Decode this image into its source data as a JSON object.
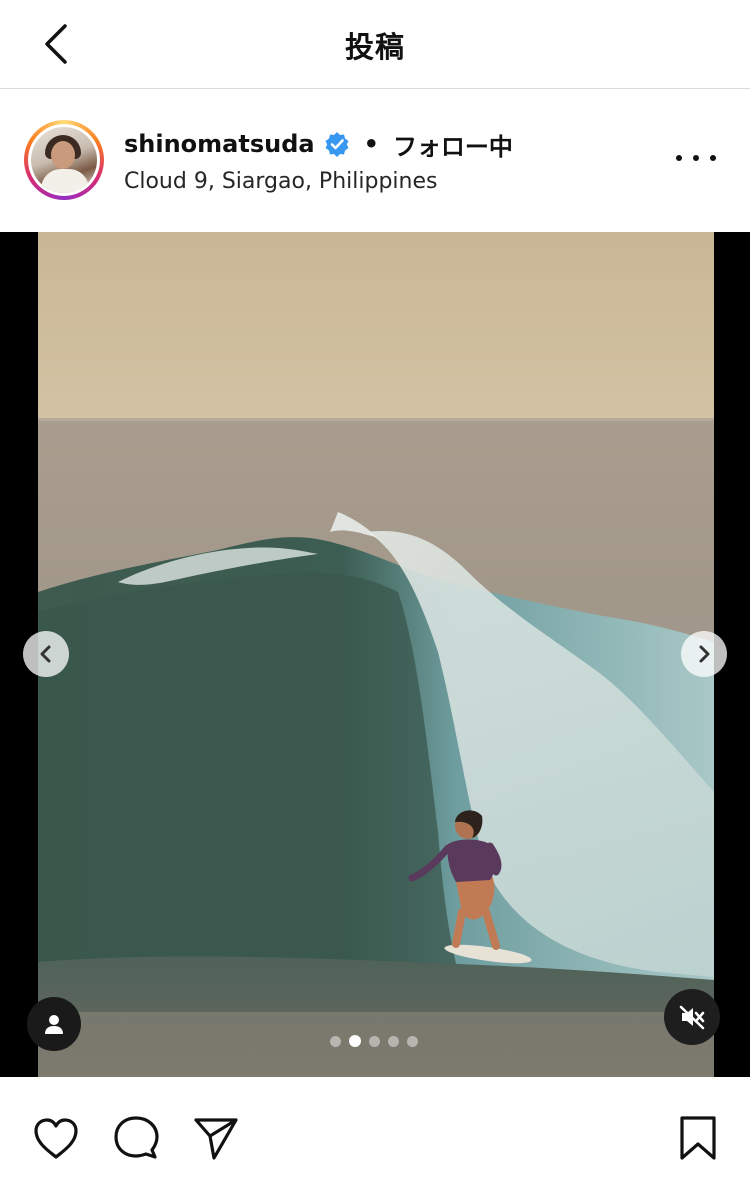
{
  "header": {
    "title": "投稿"
  },
  "post": {
    "username": "shinomatsuda",
    "separator": "•",
    "follow_state": "フォロー中",
    "location": "Cloud 9, Siargao, Philippines"
  },
  "carousel": {
    "slide_count": 5,
    "active_index": 1
  },
  "icons": {
    "back": "back-arrow-icon",
    "verified": "verified-badge-icon",
    "more": "more-options-icon",
    "prev": "chevron-left-icon",
    "next": "chevron-right-icon",
    "tag": "user-tag-icon",
    "mute": "muted-speaker-icon",
    "like": "heart-icon",
    "comment": "comment-icon",
    "share": "send-icon",
    "save": "bookmark-icon"
  },
  "colors": {
    "verified": "#3897f0",
    "divider": "#dbdbdb",
    "ring_start": "#feda75",
    "ring_end": "#962fbf"
  }
}
